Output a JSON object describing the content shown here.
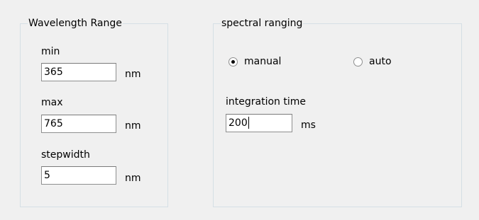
{
  "wavelength_range": {
    "title": "Wavelength Range",
    "min": {
      "label": "min",
      "value": "365",
      "unit": "nm"
    },
    "max": {
      "label": "max",
      "value": "765",
      "unit": "nm"
    },
    "stepwidth": {
      "label": "stepwidth",
      "value": "5",
      "unit": "nm"
    }
  },
  "spectral_ranging": {
    "title": "spectral ranging",
    "radio_manual": {
      "label": "manual",
      "selected": true
    },
    "radio_auto": {
      "label": "auto",
      "selected": false
    },
    "integration_time": {
      "label": "integration time",
      "value": "200",
      "unit": "ms"
    }
  }
}
